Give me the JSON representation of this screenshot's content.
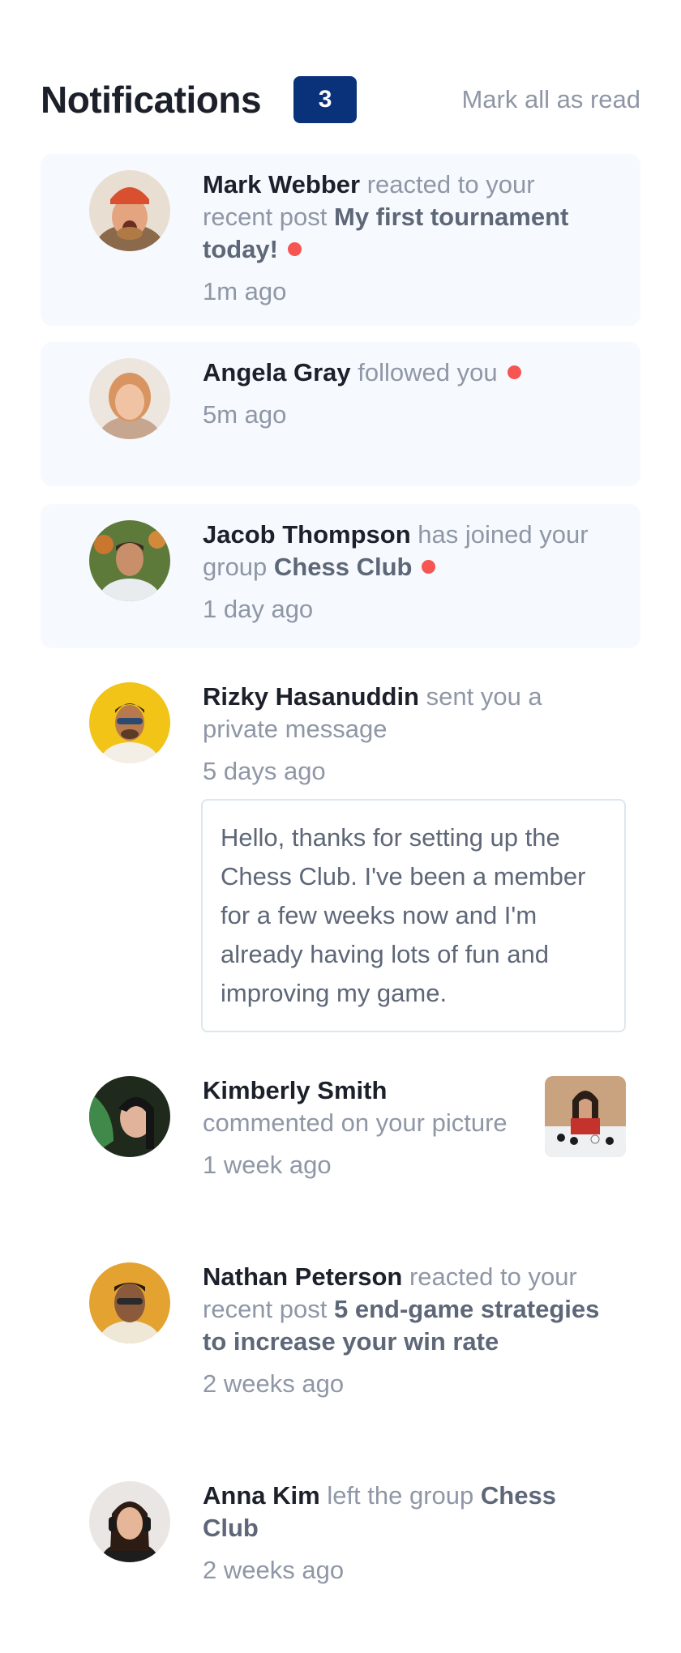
{
  "header": {
    "title": "Notifications",
    "unread_count": "3",
    "mark_all_label": "Mark all as read"
  },
  "notifications": [
    {
      "name": "Mark Webber",
      "action": "reacted to your recent post",
      "target": "My first tournament today!",
      "time": "1m ago",
      "unread": true
    },
    {
      "name": "Angela Gray",
      "action": "followed you",
      "time": "5m ago",
      "unread": true
    },
    {
      "name": "Jacob Thompson",
      "action": "has joined your group",
      "target": "Chess Club",
      "time": "1 day ago",
      "unread": true
    },
    {
      "name": "Rizky Hasanuddin",
      "action": "sent you a private message",
      "time": "5 days ago",
      "unread": false,
      "message": "Hello, thanks for setting up the Chess Club. I've been a member for a few weeks now and I'm already having lots of fun and improving my game."
    },
    {
      "name": "Kimberly Smith",
      "action": "commented on your picture",
      "time": "1 week ago",
      "unread": false
    },
    {
      "name": "Nathan Peterson",
      "action": "reacted to your recent post",
      "target": "5 end-game strategies to increase your win rate",
      "time": "2 weeks ago",
      "unread": false
    },
    {
      "name": "Anna Kim",
      "action": "left the group",
      "target": "Chess Club",
      "time": "2 weeks ago",
      "unread": false
    }
  ],
  "colors": {
    "badge_bg": "#0a327b",
    "unread_card_bg": "#f6f9fd",
    "unread_dot": "#f65552",
    "heading": "#1c202b",
    "muted": "#8f97a6"
  },
  "icons": {
    "unread_dot": "red-dot-icon",
    "avatars": "user-avatar-photo",
    "thumbnail": "chess-picture-thumbnail"
  }
}
